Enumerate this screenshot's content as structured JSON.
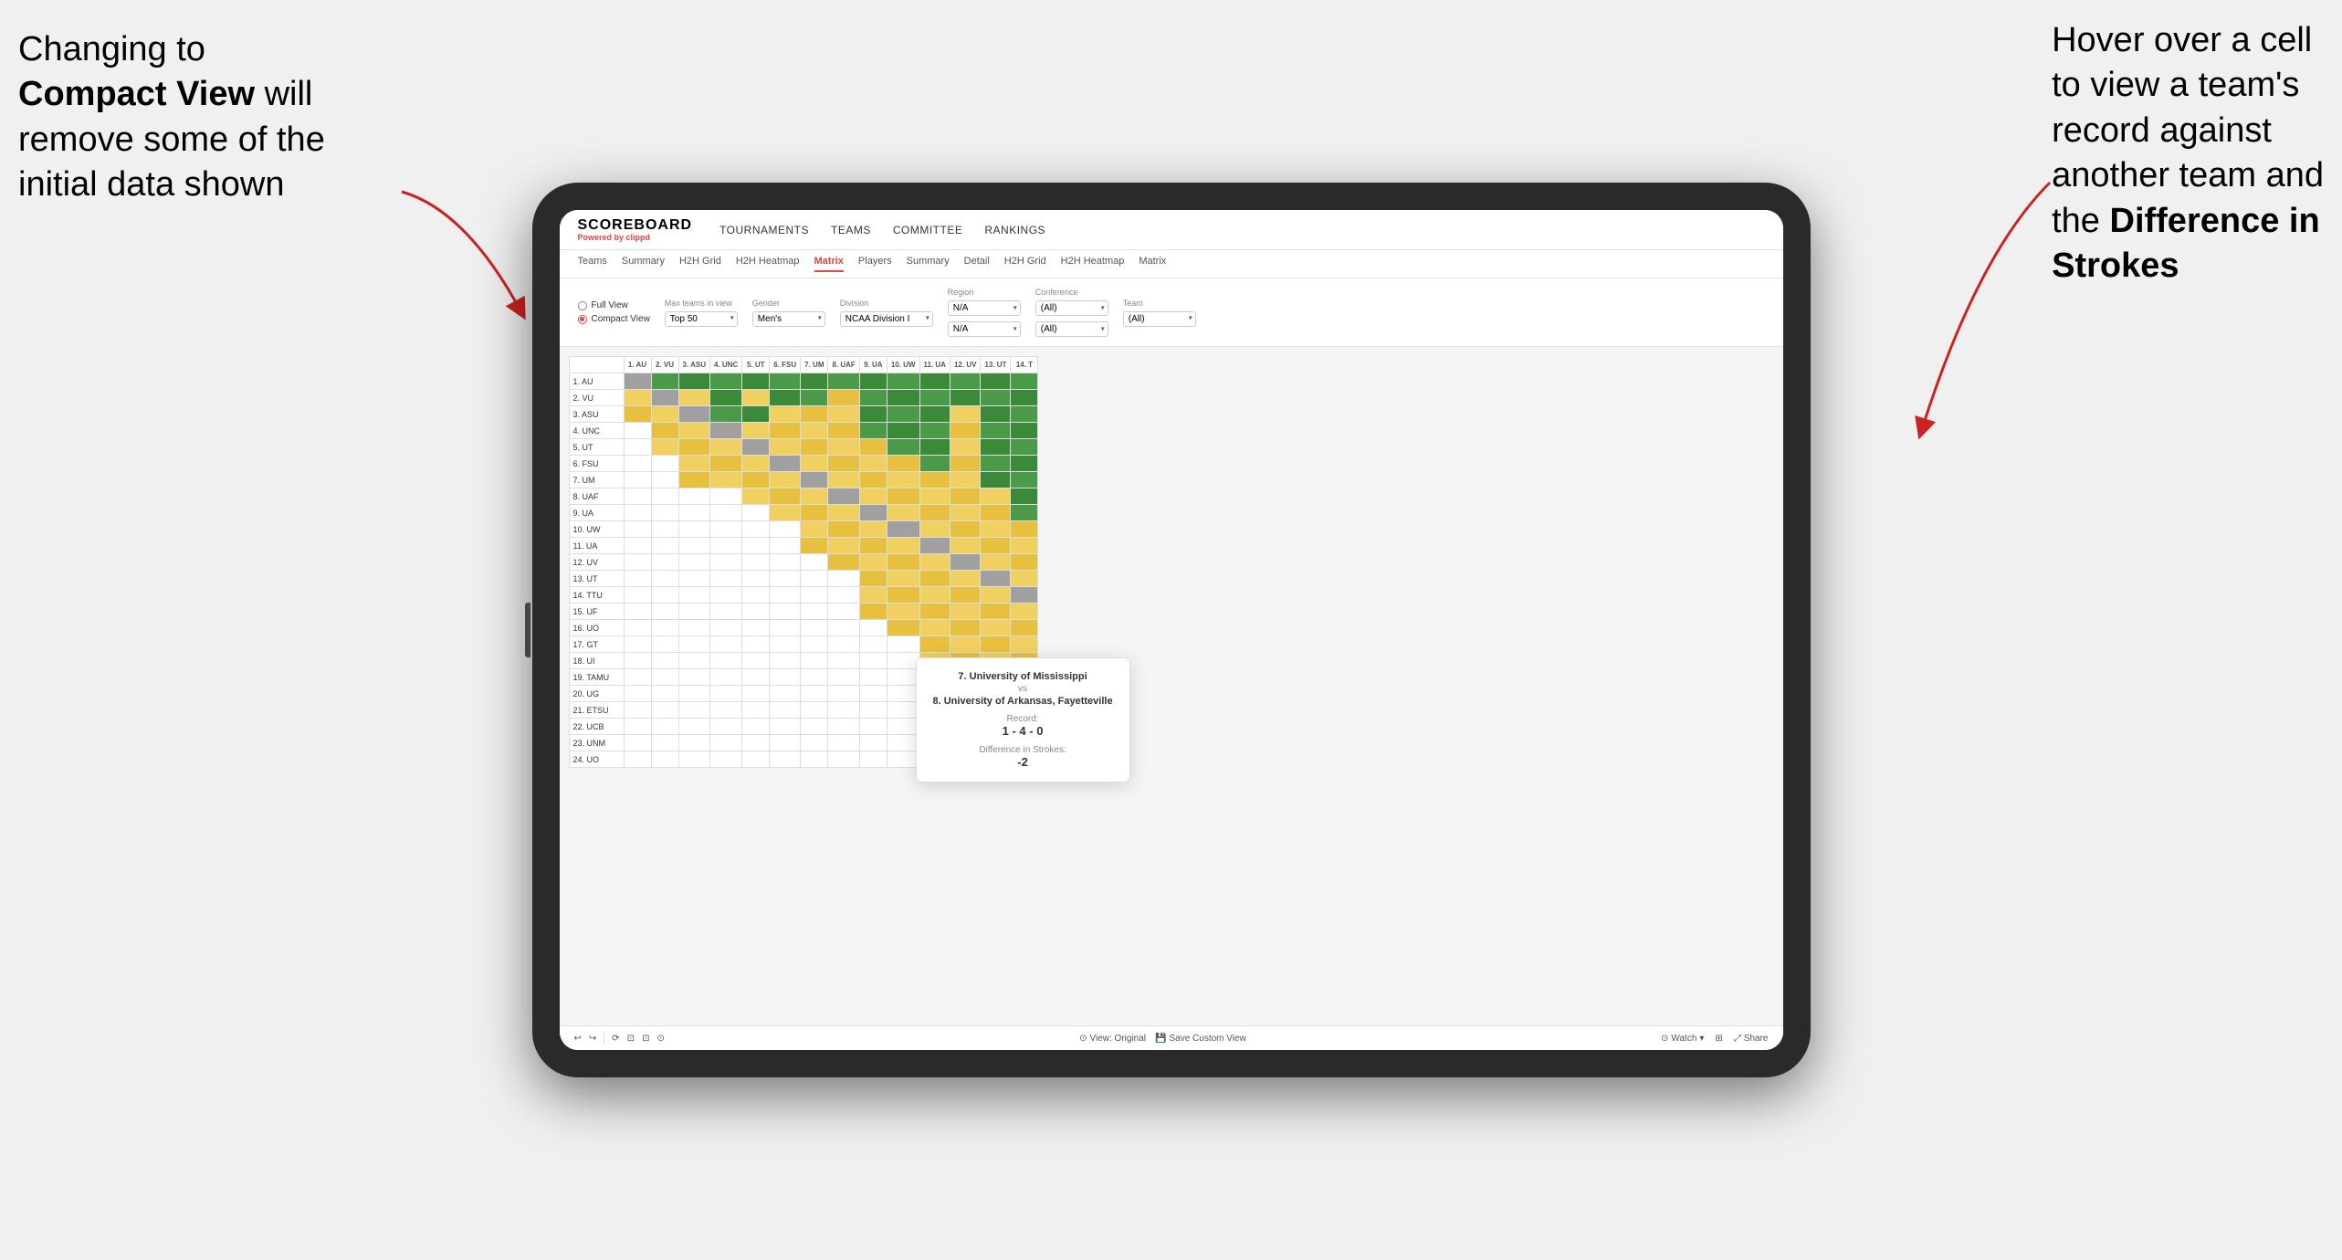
{
  "annotations": {
    "left_text_line1": "Changing to",
    "left_text_line2": "Compact View will",
    "left_text_line3": "remove some of the",
    "left_text_line4": "initial data shown",
    "right_text_line1": "Hover over a cell",
    "right_text_line2": "to view a team's",
    "right_text_line3": "record against",
    "right_text_line4": "another team and",
    "right_text_line5": "the ",
    "right_text_bold": "Difference in",
    "right_text_line6": "Strokes"
  },
  "nav": {
    "logo_title": "SCOREBOARD",
    "logo_sub_pre": "Powered by ",
    "logo_sub_brand": "clippd",
    "items": [
      "TOURNAMENTS",
      "TEAMS",
      "COMMITTEE",
      "RANKINGS"
    ]
  },
  "sub_nav": {
    "items": [
      "Teams",
      "Summary",
      "H2H Grid",
      "H2H Heatmap",
      "Matrix",
      "Players",
      "Summary",
      "Detail",
      "H2H Grid",
      "H2H Heatmap",
      "Matrix"
    ],
    "active_index": 4
  },
  "controls": {
    "view_options": [
      "Full View",
      "Compact View"
    ],
    "selected_view": "Compact View",
    "max_teams_label": "Max teams in view",
    "max_teams_value": "Top 50",
    "gender_label": "Gender",
    "gender_value": "Men's",
    "division_label": "Division",
    "division_value": "NCAA Division I",
    "region_label": "Region",
    "region_value": "N/A",
    "conference_label": "Conference",
    "conference_values": [
      "(All)",
      "(All)"
    ],
    "team_label": "Team",
    "team_value": "(All)"
  },
  "matrix": {
    "col_headers": [
      "1. AU",
      "2. VU",
      "3. ASU",
      "4. UNC",
      "5. UT",
      "6. FSU",
      "7. UM",
      "8. UAF",
      "9. UA",
      "10. UW",
      "11. UA",
      "12. UV",
      "13. UT",
      "14. T"
    ],
    "rows": [
      {
        "label": "1. AU",
        "cells": [
          "self",
          "g",
          "g",
          "g",
          "g",
          "g",
          "g",
          "g",
          "g",
          "g",
          "g",
          "g",
          "g",
          "g"
        ]
      },
      {
        "label": "2. VU",
        "cells": [
          "y",
          "self",
          "y",
          "g",
          "y",
          "g",
          "g",
          "y",
          "g",
          "g",
          "g",
          "g",
          "g",
          "g"
        ]
      },
      {
        "label": "3. ASU",
        "cells": [
          "y",
          "y",
          "self",
          "g",
          "g",
          "y",
          "y",
          "y",
          "g",
          "g",
          "g",
          "y",
          "g",
          "g"
        ]
      },
      {
        "label": "4. UNC",
        "cells": [
          "w",
          "y",
          "y",
          "self",
          "y",
          "y",
          "y",
          "y",
          "g",
          "g",
          "g",
          "y",
          "g",
          "g"
        ]
      },
      {
        "label": "5. UT",
        "cells": [
          "w",
          "y",
          "y",
          "y",
          "self",
          "y",
          "y",
          "y",
          "y",
          "g",
          "g",
          "y",
          "g",
          "g"
        ]
      },
      {
        "label": "6. FSU",
        "cells": [
          "w",
          "w",
          "y",
          "y",
          "y",
          "self",
          "y",
          "y",
          "y",
          "y",
          "g",
          "y",
          "g",
          "g"
        ]
      },
      {
        "label": "7. UM",
        "cells": [
          "w",
          "w",
          "y",
          "y",
          "y",
          "y",
          "self",
          "y",
          "y",
          "y",
          "y",
          "y",
          "g",
          "g"
        ]
      },
      {
        "label": "8. UAF",
        "cells": [
          "w",
          "w",
          "w",
          "w",
          "y",
          "y",
          "y",
          "self",
          "y",
          "y",
          "y",
          "y",
          "y",
          "g"
        ]
      },
      {
        "label": "9. UA",
        "cells": [
          "w",
          "w",
          "w",
          "w",
          "w",
          "y",
          "y",
          "y",
          "self",
          "y",
          "y",
          "y",
          "y",
          "g"
        ]
      },
      {
        "label": "10. UW",
        "cells": [
          "w",
          "w",
          "w",
          "w",
          "w",
          "w",
          "y",
          "y",
          "y",
          "self",
          "y",
          "y",
          "y",
          "y"
        ]
      },
      {
        "label": "11. UA",
        "cells": [
          "w",
          "w",
          "w",
          "w",
          "w",
          "w",
          "y",
          "y",
          "y",
          "y",
          "self",
          "y",
          "y",
          "y"
        ]
      },
      {
        "label": "12. UV",
        "cells": [
          "w",
          "w",
          "w",
          "w",
          "w",
          "w",
          "w",
          "y",
          "y",
          "y",
          "y",
          "self",
          "y",
          "y"
        ]
      },
      {
        "label": "13. UT",
        "cells": [
          "w",
          "w",
          "w",
          "w",
          "w",
          "w",
          "w",
          "w",
          "y",
          "y",
          "y",
          "y",
          "self",
          "y"
        ]
      },
      {
        "label": "14. TTU",
        "cells": [
          "w",
          "w",
          "w",
          "w",
          "w",
          "w",
          "w",
          "w",
          "y",
          "y",
          "y",
          "y",
          "y",
          "self"
        ]
      },
      {
        "label": "15. UF",
        "cells": [
          "w",
          "w",
          "w",
          "w",
          "w",
          "w",
          "w",
          "w",
          "y",
          "y",
          "y",
          "y",
          "y",
          "y"
        ]
      },
      {
        "label": "16. UO",
        "cells": [
          "w",
          "w",
          "w",
          "w",
          "w",
          "w",
          "w",
          "w",
          "w",
          "y",
          "y",
          "y",
          "y",
          "y"
        ]
      },
      {
        "label": "17. GT",
        "cells": [
          "w",
          "w",
          "w",
          "w",
          "w",
          "w",
          "w",
          "w",
          "w",
          "w",
          "y",
          "y",
          "y",
          "y"
        ]
      },
      {
        "label": "18. UI",
        "cells": [
          "w",
          "w",
          "w",
          "w",
          "w",
          "w",
          "w",
          "w",
          "w",
          "w",
          "y",
          "y",
          "y",
          "y"
        ]
      },
      {
        "label": "19. TAMU",
        "cells": [
          "w",
          "w",
          "w",
          "w",
          "w",
          "w",
          "w",
          "w",
          "w",
          "w",
          "w",
          "y",
          "y",
          "y"
        ]
      },
      {
        "label": "20. UG",
        "cells": [
          "w",
          "w",
          "w",
          "w",
          "w",
          "w",
          "w",
          "w",
          "w",
          "w",
          "w",
          "w",
          "y",
          "y"
        ]
      },
      {
        "label": "21. ETSU",
        "cells": [
          "w",
          "w",
          "w",
          "w",
          "w",
          "w",
          "w",
          "w",
          "w",
          "w",
          "w",
          "w",
          "y",
          "y"
        ]
      },
      {
        "label": "22. UCB",
        "cells": [
          "w",
          "w",
          "w",
          "w",
          "w",
          "w",
          "w",
          "w",
          "w",
          "w",
          "w",
          "w",
          "y",
          "y"
        ]
      },
      {
        "label": "23. UNM",
        "cells": [
          "w",
          "w",
          "w",
          "w",
          "w",
          "w",
          "w",
          "w",
          "w",
          "w",
          "w",
          "w",
          "w",
          "y"
        ]
      },
      {
        "label": "24. UO",
        "cells": [
          "w",
          "w",
          "w",
          "w",
          "w",
          "w",
          "w",
          "w",
          "w",
          "w",
          "w",
          "w",
          "w",
          "w"
        ]
      }
    ]
  },
  "tooltip": {
    "team1": "7. University of Mississippi",
    "vs": "vs",
    "team2": "8. University of Arkansas, Fayetteville",
    "record_label": "Record:",
    "record_value": "1 - 4 - 0",
    "strokes_label": "Difference in Strokes:",
    "strokes_value": "-2"
  },
  "toolbar": {
    "undo": "↩",
    "redo": "↪",
    "icons": [
      "⟳",
      "⊡",
      "⊡",
      "⊙"
    ],
    "view_original": "View: Original",
    "save_custom": "Save Custom View",
    "watch": "Watch",
    "share": "Share"
  }
}
